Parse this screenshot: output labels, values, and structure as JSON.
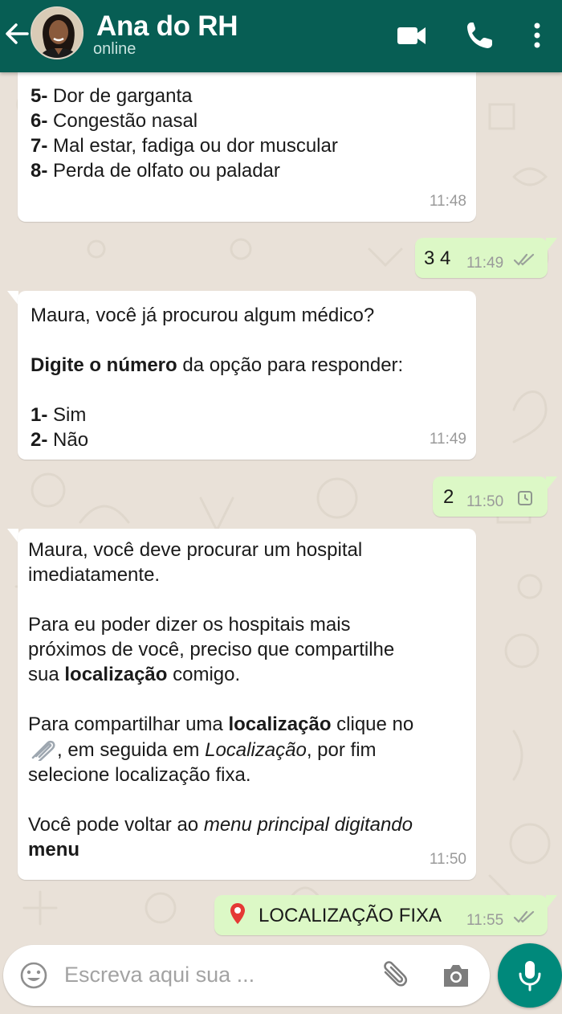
{
  "header": {
    "title": "Ana do RH",
    "status": "online",
    "colors": {
      "bar": "#075e54",
      "status": "#c8e3df"
    },
    "icons": [
      "back-arrow-icon",
      "video-call-icon",
      "phone-icon",
      "more-vert-icon"
    ]
  },
  "messages": [
    {
      "direction": "in",
      "lines": [
        {
          "num": "5-",
          "text": " Dor de garganta"
        },
        {
          "num": "6-",
          "text": " Congestão nasal"
        },
        {
          "num": "7-",
          "text": " Mal estar, fadiga ou dor muscular"
        },
        {
          "num": "8-",
          "text": " Perda de olfato ou paladar"
        }
      ],
      "time": "11:48"
    },
    {
      "direction": "out",
      "text": "3 4",
      "time": "11:49",
      "status": "read-double-check-icon"
    },
    {
      "direction": "in",
      "p1": "Maura, você já procurou algum médico?",
      "p2_bold": "Digite o número",
      "p2_rest": " da opção para responder:",
      "opt1_num": "1-",
      "opt1_text": " Sim",
      "opt2_num": "2-",
      "opt2_text": " Não",
      "time": "11:49"
    },
    {
      "direction": "out",
      "text": "2",
      "time": "11:50",
      "status": "pending-clock-icon"
    },
    {
      "direction": "in",
      "p1_line1": "Maura, você deve procurar um hospital",
      "p1_line2": "imediatamente.",
      "p2_line1": "Para eu poder dizer os hospitais mais",
      "p2_line2": "próximos de você, preciso que compartilhe",
      "p2_line3_a": "sua ",
      "p2_line3_bold": "localização",
      "p2_line3_b": " comigo.",
      "p3_line1_a": "Para compartilhar uma ",
      "p3_line1_bold": "localização",
      "p3_line1_b": " clique no",
      "p3_line2_a": ", em seguida em ",
      "p3_line2_italic": "Localização",
      "p3_line2_b": ", por fim",
      "p3_line3": "selecione localização fixa.",
      "p4_line1_a": "Você pode voltar ao ",
      "p4_line1_italic": "menu principal digitando",
      "p4_line2_bold": "menu",
      "time": "11:50"
    },
    {
      "direction": "out",
      "text": "LOCALIZAÇÃO FIXA",
      "icon": "location-pin-icon",
      "time": "11:55",
      "status": "read-double-check-icon"
    }
  ],
  "composer": {
    "placeholder": "Escreva aqui sua ...",
    "icons": [
      "emoji-icon",
      "attach-clip-icon",
      "camera-icon",
      "microphone-icon"
    ],
    "mic_color": "#00897b"
  },
  "colors": {
    "chat_bg": "#e9e1d8",
    "bubble_in": "#ffffff",
    "bubble_out": "#dcf8c6"
  }
}
